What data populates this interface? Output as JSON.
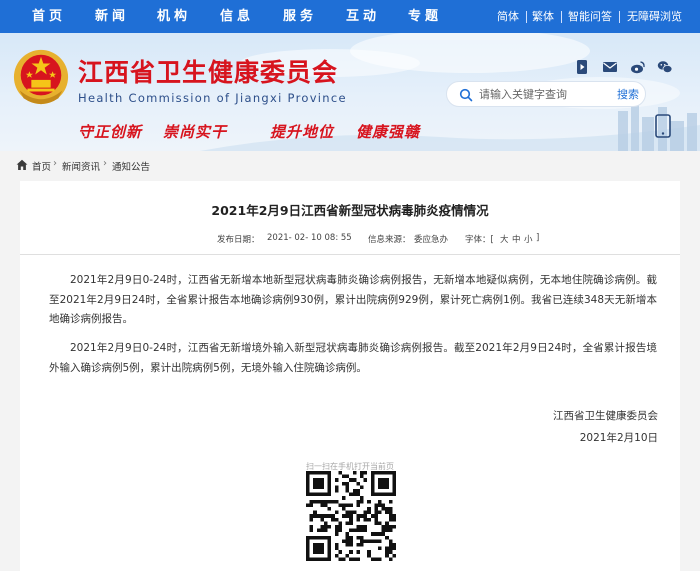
{
  "nav": {
    "items": [
      "首页",
      "新闻",
      "机构",
      "信息",
      "服务",
      "互动",
      "专题"
    ],
    "utility": [
      "简体",
      "繁体",
      "智能问答",
      "无障碍浏览"
    ]
  },
  "header": {
    "title": "江西省卫生健康委员会",
    "title_en": "Health Commission of Jiangxi Province",
    "slogans": [
      "守正创新",
      "崇尚实干",
      "提升地位",
      "健康强赣"
    ]
  },
  "search": {
    "placeholder": "请输入关键字查询",
    "button": "搜索"
  },
  "breadcrumb": [
    "首页",
    "新闻资讯",
    "通知公告"
  ],
  "article": {
    "title": "2021年2月9日江西省新型冠状病毒肺炎疫情情况",
    "date_label": "发布日期：",
    "date": "2021- 02- 10 08: 55",
    "source_label": "信息来源：",
    "source": "委应急办",
    "font_label": "字体：[",
    "font_large": "大",
    "font_medium": "中",
    "font_small": "小",
    "font_end": "]",
    "paragraphs": [
      "2021年2月9日0-24时，江西省无新增本地新型冠状病毒肺炎确诊病例报告，无新增本地疑似病例，无本地住院确诊病例。截至2021年2月9日24时，全省累计报告本地确诊病例930例，累计出院病例929例，累计死亡病例1例。我省已连续348天无新增本地确诊病例报告。",
      "2021年2月9日0-24时，江西省无新增境外输入新型冠状病毒肺炎确诊病例报告。截至2021年2月9日24时，全省累计报告境外输入确诊病例5例，累计出院病例5例，无境外输入住院确诊病例。"
    ],
    "signature": "江西省卫生健康委员会",
    "sign_date": "2021年2月10日",
    "qr_caption": "扫一扫在手机打开当前页"
  },
  "colors": {
    "nav_bg": "#1f6fd6",
    "title_red": "#d7141e",
    "link_blue": "#1f6fd6"
  },
  "icons": [
    "video-icon",
    "mail-icon",
    "weibo-icon",
    "wechat-icon",
    "search-icon",
    "mobile-icon",
    "home-icon",
    "qr-code-icon",
    "emblem-icon"
  ]
}
